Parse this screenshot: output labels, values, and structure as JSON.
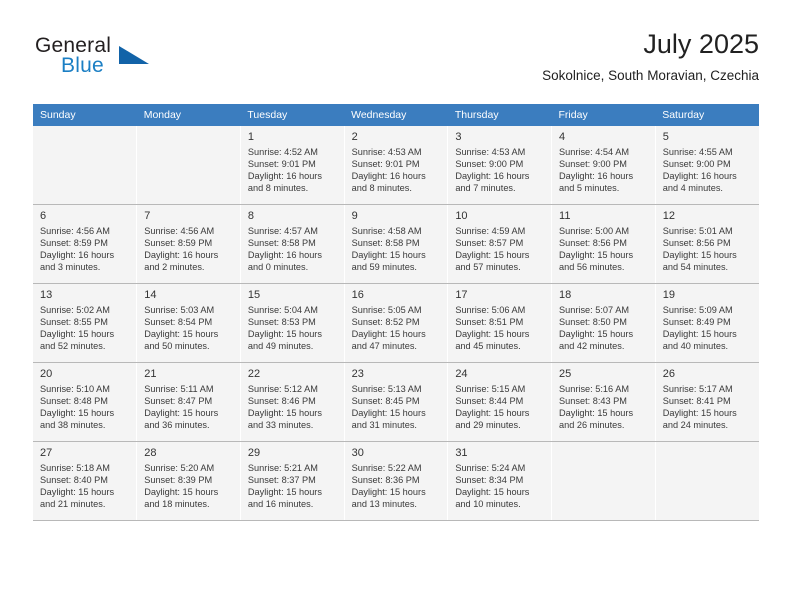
{
  "brand": {
    "name_top": "General",
    "name_bottom": "Blue",
    "accent_color": "#1263a8",
    "blue_text_color": "#1b7fc4",
    "triangle_icon": "brand-triangle-icon"
  },
  "header": {
    "title": "July 2025",
    "subtitle": "Sokolnice, South Moravian, Czechia"
  },
  "calendar": {
    "header_background": "#3b7dbf",
    "header_text_color": "#ffffff",
    "shaded_row_background": "#f4f4f4",
    "weekdays": [
      "Sunday",
      "Monday",
      "Tuesday",
      "Wednesday",
      "Thursday",
      "Friday",
      "Saturday"
    ],
    "weeks": [
      [
        {
          "day": "",
          "detail": ""
        },
        {
          "day": "",
          "detail": ""
        },
        {
          "day": "1",
          "detail": "Sunrise: 4:52 AM\nSunset: 9:01 PM\nDaylight: 16 hours\nand 8 minutes."
        },
        {
          "day": "2",
          "detail": "Sunrise: 4:53 AM\nSunset: 9:01 PM\nDaylight: 16 hours\nand 8 minutes."
        },
        {
          "day": "3",
          "detail": "Sunrise: 4:53 AM\nSunset: 9:00 PM\nDaylight: 16 hours\nand 7 minutes."
        },
        {
          "day": "4",
          "detail": "Sunrise: 4:54 AM\nSunset: 9:00 PM\nDaylight: 16 hours\nand 5 minutes."
        },
        {
          "day": "5",
          "detail": "Sunrise: 4:55 AM\nSunset: 9:00 PM\nDaylight: 16 hours\nand 4 minutes."
        }
      ],
      [
        {
          "day": "6",
          "detail": "Sunrise: 4:56 AM\nSunset: 8:59 PM\nDaylight: 16 hours\nand 3 minutes."
        },
        {
          "day": "7",
          "detail": "Sunrise: 4:56 AM\nSunset: 8:59 PM\nDaylight: 16 hours\nand 2 minutes."
        },
        {
          "day": "8",
          "detail": "Sunrise: 4:57 AM\nSunset: 8:58 PM\nDaylight: 16 hours\nand 0 minutes."
        },
        {
          "day": "9",
          "detail": "Sunrise: 4:58 AM\nSunset: 8:58 PM\nDaylight: 15 hours\nand 59 minutes."
        },
        {
          "day": "10",
          "detail": "Sunrise: 4:59 AM\nSunset: 8:57 PM\nDaylight: 15 hours\nand 57 minutes."
        },
        {
          "day": "11",
          "detail": "Sunrise: 5:00 AM\nSunset: 8:56 PM\nDaylight: 15 hours\nand 56 minutes."
        },
        {
          "day": "12",
          "detail": "Sunrise: 5:01 AM\nSunset: 8:56 PM\nDaylight: 15 hours\nand 54 minutes."
        }
      ],
      [
        {
          "day": "13",
          "detail": "Sunrise: 5:02 AM\nSunset: 8:55 PM\nDaylight: 15 hours\nand 52 minutes."
        },
        {
          "day": "14",
          "detail": "Sunrise: 5:03 AM\nSunset: 8:54 PM\nDaylight: 15 hours\nand 50 minutes."
        },
        {
          "day": "15",
          "detail": "Sunrise: 5:04 AM\nSunset: 8:53 PM\nDaylight: 15 hours\nand 49 minutes."
        },
        {
          "day": "16",
          "detail": "Sunrise: 5:05 AM\nSunset: 8:52 PM\nDaylight: 15 hours\nand 47 minutes."
        },
        {
          "day": "17",
          "detail": "Sunrise: 5:06 AM\nSunset: 8:51 PM\nDaylight: 15 hours\nand 45 minutes."
        },
        {
          "day": "18",
          "detail": "Sunrise: 5:07 AM\nSunset: 8:50 PM\nDaylight: 15 hours\nand 42 minutes."
        },
        {
          "day": "19",
          "detail": "Sunrise: 5:09 AM\nSunset: 8:49 PM\nDaylight: 15 hours\nand 40 minutes."
        }
      ],
      [
        {
          "day": "20",
          "detail": "Sunrise: 5:10 AM\nSunset: 8:48 PM\nDaylight: 15 hours\nand 38 minutes."
        },
        {
          "day": "21",
          "detail": "Sunrise: 5:11 AM\nSunset: 8:47 PM\nDaylight: 15 hours\nand 36 minutes."
        },
        {
          "day": "22",
          "detail": "Sunrise: 5:12 AM\nSunset: 8:46 PM\nDaylight: 15 hours\nand 33 minutes."
        },
        {
          "day": "23",
          "detail": "Sunrise: 5:13 AM\nSunset: 8:45 PM\nDaylight: 15 hours\nand 31 minutes."
        },
        {
          "day": "24",
          "detail": "Sunrise: 5:15 AM\nSunset: 8:44 PM\nDaylight: 15 hours\nand 29 minutes."
        },
        {
          "day": "25",
          "detail": "Sunrise: 5:16 AM\nSunset: 8:43 PM\nDaylight: 15 hours\nand 26 minutes."
        },
        {
          "day": "26",
          "detail": "Sunrise: 5:17 AM\nSunset: 8:41 PM\nDaylight: 15 hours\nand 24 minutes."
        }
      ],
      [
        {
          "day": "27",
          "detail": "Sunrise: 5:18 AM\nSunset: 8:40 PM\nDaylight: 15 hours\nand 21 minutes."
        },
        {
          "day": "28",
          "detail": "Sunrise: 5:20 AM\nSunset: 8:39 PM\nDaylight: 15 hours\nand 18 minutes."
        },
        {
          "day": "29",
          "detail": "Sunrise: 5:21 AM\nSunset: 8:37 PM\nDaylight: 15 hours\nand 16 minutes."
        },
        {
          "day": "30",
          "detail": "Sunrise: 5:22 AM\nSunset: 8:36 PM\nDaylight: 15 hours\nand 13 minutes."
        },
        {
          "day": "31",
          "detail": "Sunrise: 5:24 AM\nSunset: 8:34 PM\nDaylight: 15 hours\nand 10 minutes."
        },
        {
          "day": "",
          "detail": ""
        },
        {
          "day": "",
          "detail": ""
        }
      ]
    ]
  }
}
